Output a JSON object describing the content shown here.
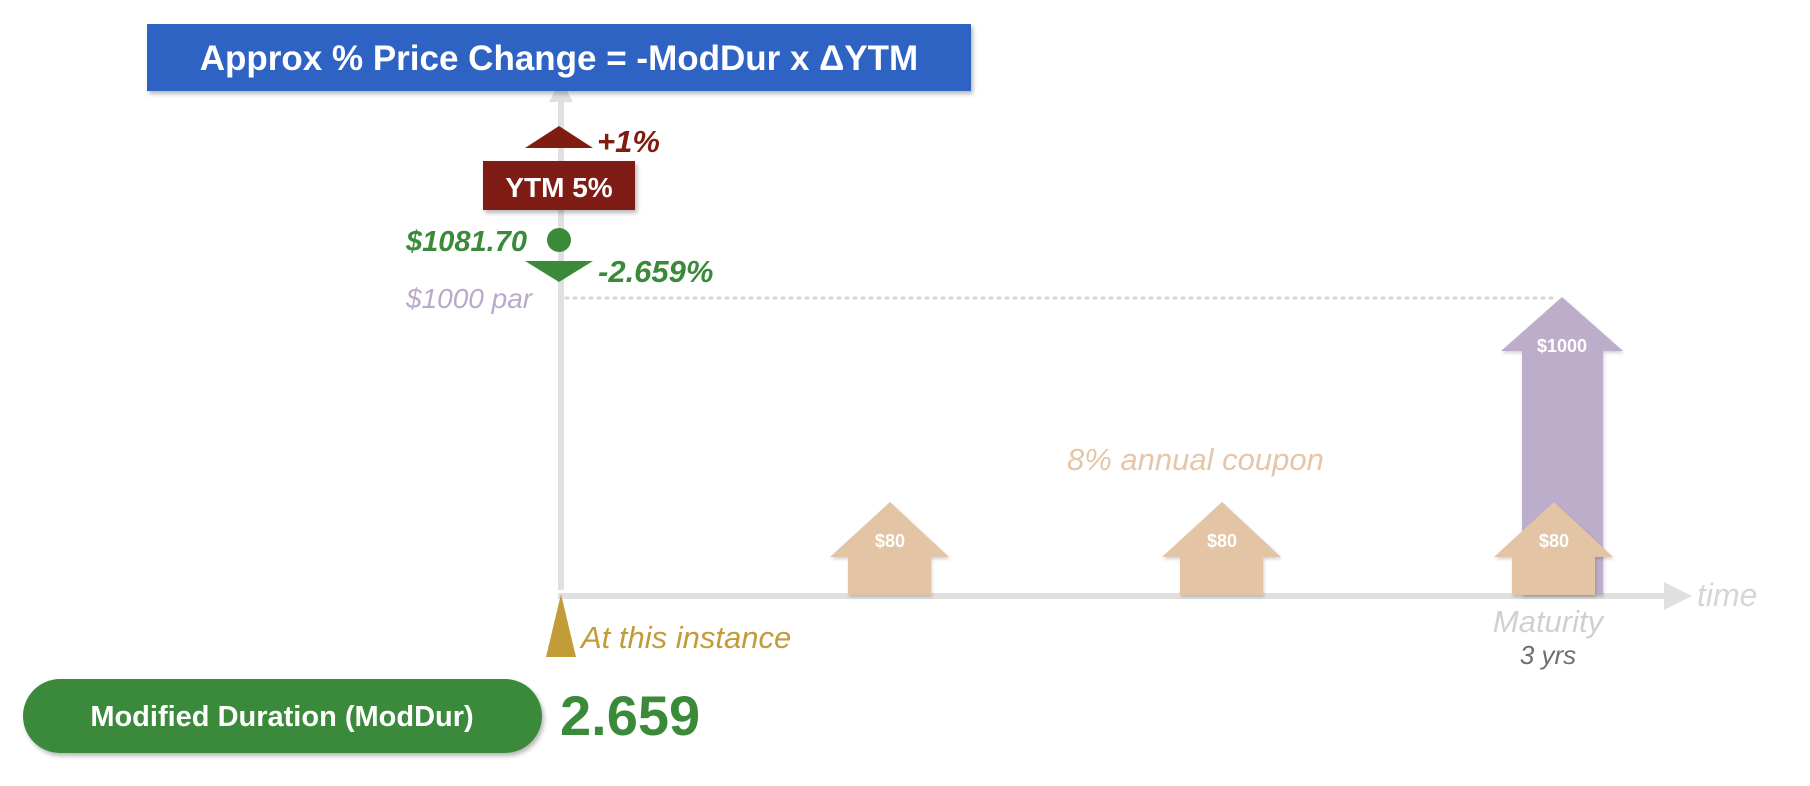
{
  "formula_banner": {
    "text": "Approx % Price Change = -ModDur x ΔYTM",
    "color": "#2d63c4"
  },
  "ytm": {
    "label": "YTM 5%",
    "change_label": "+1%",
    "color": "#7f1d12"
  },
  "price": {
    "label": "$1081.70",
    "change_label": "-2.659%",
    "color": "#3b8a3a"
  },
  "par_label": "$1000 par",
  "coupon_label": "8% annual coupon",
  "cash_flows": [
    {
      "label": "$80",
      "year": 1
    },
    {
      "label": "$80",
      "year": 2
    },
    {
      "label": "$80",
      "year": 3
    }
  ],
  "principal": {
    "label": "$1000",
    "color": "#bcaecb"
  },
  "coupon_color": "#e3c4a5",
  "time_axis": {
    "time_label": "time",
    "instance_label": "At this instance",
    "maturity_label": "Maturity",
    "maturity_years": "3 yrs"
  },
  "modified_duration": {
    "label": "Modified Duration (ModDur)",
    "value": "2.659",
    "color": "#3b8a3a"
  }
}
